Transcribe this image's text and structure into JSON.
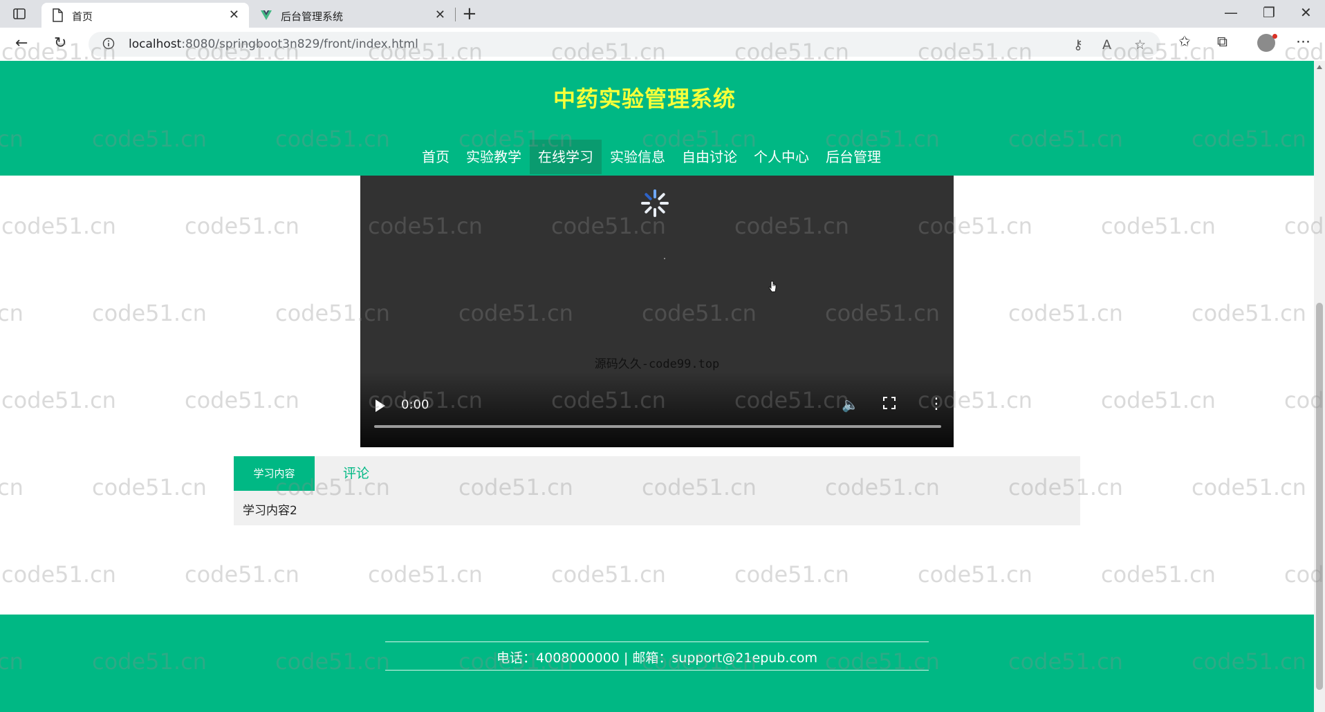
{
  "browser": {
    "tabs": [
      {
        "title": "首页",
        "active": true
      },
      {
        "title": "后台管理系统",
        "active": false
      }
    ],
    "url_host": "localhost",
    "url_path": ":8080/springboot3n829/front/index.html"
  },
  "site": {
    "title": "中药实验管理系统",
    "nav": [
      "首页",
      "实验教学",
      "在线学习",
      "实验信息",
      "自由讨论",
      "个人中心",
      "后台管理"
    ],
    "active_nav": "在线学习"
  },
  "video": {
    "caption": "源码久久-code99.top",
    "time": "0:00"
  },
  "content_tabs": {
    "active_label": "学习内容",
    "other_label": "评论",
    "body": "学习内容2"
  },
  "footer": {
    "info": "电话：4008000000 | 邮箱：support@21epub.com"
  },
  "watermark": {
    "text": "code51.cn"
  },
  "colors": {
    "header": "#00b884",
    "title": "#f6ff3a",
    "nav_active": "#0a9b6f",
    "video_bg": "#323232",
    "panel_bg": "#f0f0f0"
  }
}
